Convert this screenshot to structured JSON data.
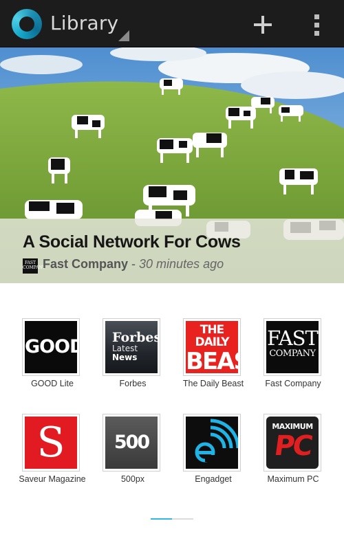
{
  "actionbar": {
    "app_icon": "circle-logo-icon",
    "title": "Library",
    "add_icon": "plus-icon",
    "overflow_icon": "overflow-menu-icon"
  },
  "hero": {
    "image": "cows-on-hillside-photo",
    "headline": "A Social Network For Cows",
    "source_logo_text": "FAST COMPANY",
    "source": "Fast Company",
    "separator": " - ",
    "time": "30 minutes ago"
  },
  "library": {
    "row1": [
      {
        "name": "GOOD Lite",
        "logo": "GOOD"
      },
      {
        "name": "Forbes",
        "logo_l1": "Forbes",
        "logo_l2": "Latest",
        "logo_l3": "News"
      },
      {
        "name": "The Daily Beast",
        "logo_l1": "THE DAILY",
        "logo_l2": "BEAST"
      },
      {
        "name": "Fast Company",
        "logo_l1": "FAST",
        "logo_l2": "COMPANY"
      }
    ],
    "row2": [
      {
        "name": "Saveur Magazine",
        "logo": "S"
      },
      {
        "name": "500px",
        "logo": "500"
      },
      {
        "name": "Engadget",
        "logo": "engadget-e-icon"
      },
      {
        "name": "Maximum PC",
        "logo_l1": "MAXIMUM",
        "logo_l2": "PC"
      }
    ]
  },
  "pager": {
    "page": 1,
    "pages": 2
  },
  "colors": {
    "actionbar_bg": "#1c1c1c",
    "accent": "#33b5e5",
    "daily_beast_red": "#e8221f",
    "saveur_red": "#e21b22"
  }
}
